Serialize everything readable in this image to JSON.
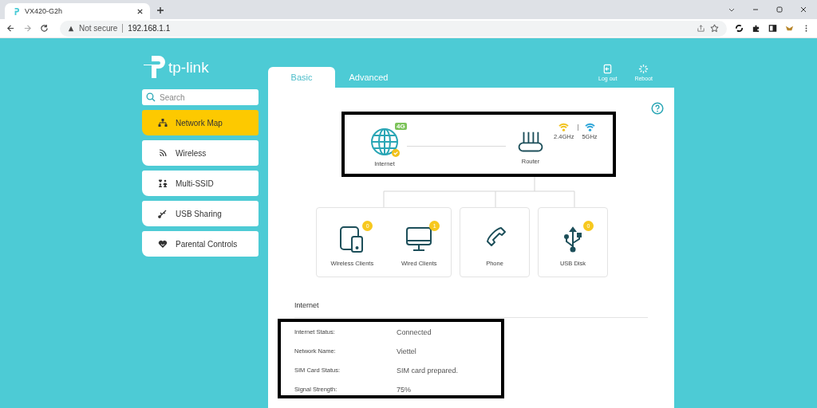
{
  "browser": {
    "tab_title": "VX420-G2h",
    "security": "Not secure",
    "url": "192.168.1.1"
  },
  "sidebar": {
    "logo": "tp-link",
    "search": {
      "placeholder": "Search"
    },
    "items": [
      {
        "label": "Network Map",
        "kind": "network",
        "selected": true
      },
      {
        "label": "Wireless",
        "kind": "wireless",
        "selected": false
      },
      {
        "label": "Multi-SSID",
        "kind": "ssid",
        "selected": false
      },
      {
        "label": "USB Sharing",
        "kind": "usb",
        "selected": false
      },
      {
        "label": "Parental Controls",
        "kind": "parental",
        "selected": false
      }
    ]
  },
  "tabs": [
    {
      "label": "Basic",
      "selected": true
    },
    {
      "label": "Advanced",
      "selected": false
    }
  ],
  "header_actions": [
    {
      "label": "Log out",
      "kind": "logout"
    },
    {
      "label": "Reboot",
      "kind": "reboot"
    }
  ],
  "topology": {
    "internet": {
      "label": "Internet",
      "badge": "4G",
      "connected": true
    },
    "router": {
      "label": "Router",
      "bands": [
        {
          "label": "2.4GHz",
          "color": "#f2c21b"
        },
        {
          "label": "5GHz",
          "color": "#2ba4d8"
        }
      ]
    },
    "groups": [
      {
        "devices": [
          {
            "label": "Wireless Clients",
            "kind": "tablet",
            "count": "0"
          },
          {
            "label": "Wired Clients",
            "kind": "monitor",
            "count": "1"
          }
        ]
      },
      {
        "devices": [
          {
            "label": "Phone",
            "kind": "phone"
          }
        ]
      },
      {
        "devices": [
          {
            "label": "USB Disk",
            "kind": "usb",
            "count": "0"
          }
        ]
      }
    ]
  },
  "internet_section": {
    "title": "Internet",
    "rows": [
      {
        "label": "Internet Status:",
        "value": "Connected"
      },
      {
        "label": "Network Name:",
        "value": "Viettel"
      },
      {
        "label": "SIM Card Status:",
        "value": "SIM card prepared."
      },
      {
        "label": "Signal Strength:",
        "value": "75%"
      }
    ]
  }
}
